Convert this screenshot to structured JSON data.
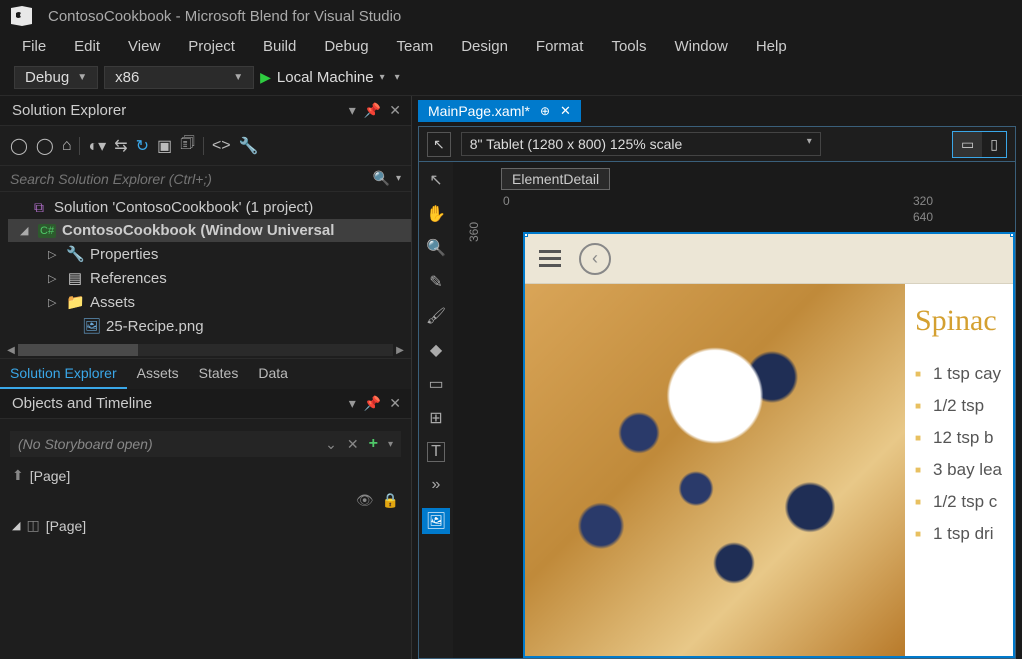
{
  "window": {
    "title": "ContosoCookbook - Microsoft Blend for Visual Studio"
  },
  "menu": [
    "File",
    "Edit",
    "View",
    "Project",
    "Build",
    "Debug",
    "Team",
    "Design",
    "Format",
    "Tools",
    "Window",
    "Help"
  ],
  "toolbar": {
    "config": "Debug",
    "platform": "x86",
    "run_target": "Local Machine"
  },
  "solution_panel": {
    "title": "Solution Explorer",
    "search_placeholder": "Search Solution Explorer (Ctrl+;)",
    "tree": {
      "solution": "Solution 'ContosoCookbook' (1 project)",
      "project": "ContosoCookbook (Window Universal",
      "nodes": [
        {
          "label": "Properties",
          "icon": "wrench"
        },
        {
          "label": "References",
          "icon": "stack"
        },
        {
          "label": "Assets",
          "icon": "folder"
        },
        {
          "label": "25-Recipe.png",
          "icon": "image"
        }
      ]
    },
    "tabs": [
      "Solution Explorer",
      "Assets",
      "States",
      "Data"
    ]
  },
  "timeline_panel": {
    "title": "Objects and Timeline",
    "storyboard_text": "(No Storyboard open)",
    "objects": [
      "[Page]",
      "[Page]"
    ]
  },
  "document": {
    "tab_name": "MainPage.xaml*",
    "device": "8\" Tablet (1280 x 800) 125% scale",
    "element_name": "ElementDetail",
    "ruler_h": [
      "0",
      "320",
      "640"
    ],
    "ruler_v": "360"
  },
  "recipe": {
    "title": "Spinac",
    "ingredients": [
      "1 tsp cay",
      "1/2 tsp",
      "12 tsp b",
      "3 bay lea",
      "1/2 tsp c",
      "1 tsp dri"
    ]
  }
}
